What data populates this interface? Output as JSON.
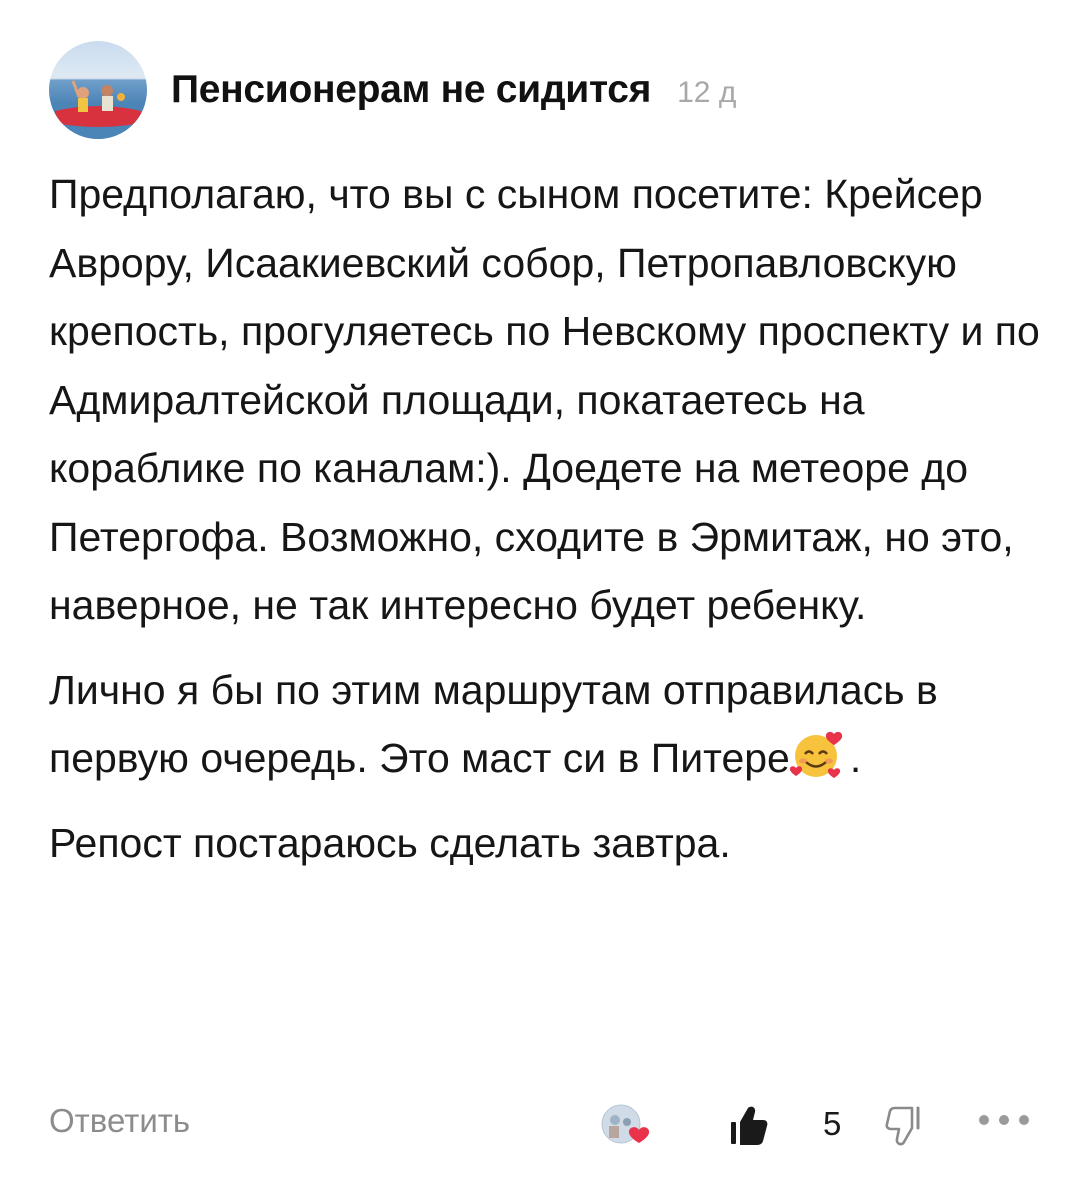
{
  "comment": {
    "author": "Пенсионерам не сидится",
    "time": "12 д",
    "paragraphs": [
      "Предполагаю, что вы с сыном посетите: Крейсер Аврору, Исаакиевский собор, Петропавловскую крепость, прогуляетесь по Невскому проспекту и по Адмиралтейской площади, покатаетесь на кораблике по каналам:). Доедете на метеоре до Петергофа. Возможно, сходите в Эрмитаж, но это, наверное, не так интересно будет ребенку.",
      {
        "before_emoji": "Лично я бы по этим маршрутам отправилась в первую очередь. Это маст си в Питере",
        "emoji": "smiling-face-with-hearts",
        "after_emoji": "."
      },
      "Репост постараюсь сделать завтра."
    ]
  },
  "footer": {
    "reply_label": "Ответить",
    "like_count": "5",
    "liked_by_icon": "avatar-with-heart-icon",
    "like_icon": "thumbs-up-icon",
    "dislike_icon": "thumbs-down-icon",
    "more_icon": "more-dots-icon"
  },
  "colors": {
    "text": "#161616",
    "muted": "#a8a8a8",
    "reply": "#8c8c8c",
    "heart": "#e8334a"
  }
}
